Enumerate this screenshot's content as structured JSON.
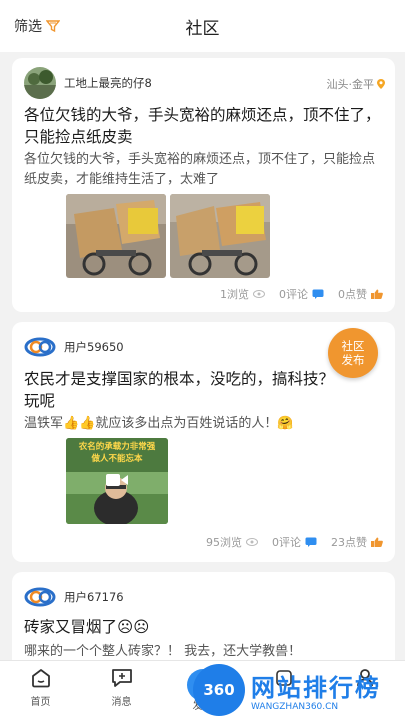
{
  "header": {
    "filter_label": "筛选",
    "title": "社区"
  },
  "posts": [
    {
      "author": "工地上最亮的仔8",
      "location": "汕头·金平",
      "title": "各位欠钱的大爷，手头宽裕的麻烦还点，顶不住了，只能捡点纸皮卖",
      "body": "各位欠钱的大爷，手头宽裕的麻烦还点，顶不住了，只能捡点纸皮卖，才能维持生活了，太难了",
      "images": [
        "cardboard-cart-photo-1",
        "cardboard-cart-photo-2"
      ],
      "views": "1浏览",
      "comments": "0评论",
      "likes": "0点赞"
    },
    {
      "author": "用户59650",
      "title": "农民才是支撑国家的根本，没吃的，搞科技？玩呢",
      "body": "温铁军👍👍就应该多出点为百姓说话的人！🤗",
      "video_caption_line1": "农名的承载力非常强",
      "video_caption_line2": "做人不能忘本",
      "views": "95浏览",
      "comments": "0评论",
      "likes": "23点赞"
    },
    {
      "author": "用户67176",
      "title": "砖家又冒烟了☹☹",
      "body": "哪来的一个个整人砖家？！ 我去，还大学教兽！"
    }
  ],
  "fab": {
    "line1": "社区",
    "line2": "发布"
  },
  "tabbar": {
    "items": [
      {
        "label": "首页",
        "icon": "home-icon"
      },
      {
        "label": "消息",
        "icon": "message-icon"
      },
      {
        "label": "发布",
        "icon": "add-icon"
      },
      {
        "label": "",
        "icon": "placeholder"
      },
      {
        "label": "",
        "icon": "user-icon"
      }
    ]
  },
  "watermark": {
    "logo": "360",
    "text": "网站排行榜",
    "url": "WANGZHAN360.CN"
  },
  "colors": {
    "accent_orange": "#f0962f",
    "like_blue": "#2f8ef0",
    "location_pin": "#f5a623"
  }
}
